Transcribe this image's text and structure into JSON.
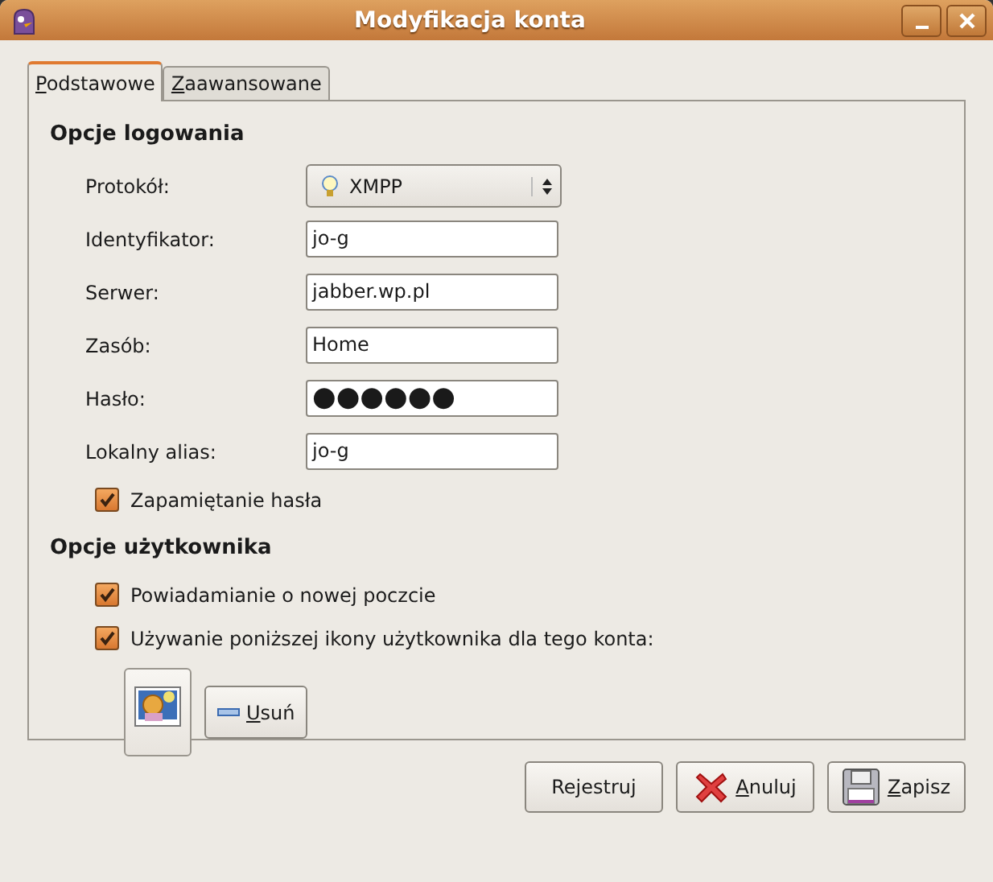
{
  "window": {
    "title": "Modyfikacja konta"
  },
  "tabs": [
    {
      "label": "Podstawowe",
      "selected": true
    },
    {
      "label": "Zaawansowane",
      "selected": false
    }
  ],
  "sections": [
    {
      "title": "Opcje logowania",
      "rows": [
        {
          "kind": "select",
          "label": "Protokół:",
          "value": "XMPP"
        },
        {
          "kind": "text",
          "label": "Identyfikator:",
          "value": "jo-g"
        },
        {
          "kind": "text",
          "label": "Serwer:",
          "value": "jabber.wp.pl"
        },
        {
          "kind": "text",
          "label": "Zasób:",
          "value": "Home"
        },
        {
          "kind": "password",
          "label": "Hasło:",
          "value": "●●●●●●"
        },
        {
          "kind": "text",
          "label": "Lokalny alias:",
          "value": "jo-g"
        },
        {
          "kind": "checkbox",
          "label": "Zapamiętanie hasła",
          "checked": true
        }
      ]
    },
    {
      "title": "Opcje użytkownika",
      "rows": [
        {
          "kind": "checkbox",
          "label": "Powiadamianie o nowej poczcie",
          "checked": true
        },
        {
          "kind": "checkbox",
          "label": "Używanie poniższej ikony użytkownika dla tego konta:",
          "checked": true
        },
        {
          "kind": "icon_buttons",
          "remove_label": "Usuń"
        }
      ]
    }
  ],
  "buttons": [
    {
      "kind": "plain",
      "label": "Rejestruj"
    },
    {
      "kind": "cancel",
      "label": "Anuluj"
    },
    {
      "kind": "save",
      "label": "Zapisz"
    }
  ]
}
